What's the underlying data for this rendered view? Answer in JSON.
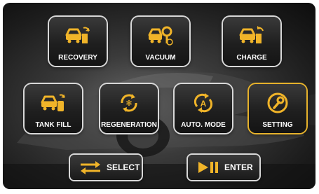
{
  "colors": {
    "accent": "#e6b22c",
    "icon": "#f0b429",
    "text": "#ffffff"
  },
  "tiles": [
    {
      "label": "RECOVERY",
      "icon": "car-recovery-icon",
      "active": false
    },
    {
      "label": "VACUUM",
      "icon": "car-vacuum-icon",
      "active": false
    },
    {
      "label": "CHARGE",
      "icon": "car-charge-icon",
      "active": false
    },
    {
      "label": "TANK FILL",
      "icon": "car-tank-fill-icon",
      "active": false
    },
    {
      "label": "REGENERATION",
      "icon": "regeneration-icon",
      "active": false
    },
    {
      "label": "AUTO. MODE",
      "icon": "auto-mode-icon",
      "active": false
    },
    {
      "label": "SETTING",
      "icon": "wrench-icon",
      "active": true
    }
  ],
  "buttons": {
    "select": {
      "label": "SELECT",
      "icon": "swap-arrows-icon"
    },
    "enter": {
      "label": "ENTER",
      "icon": "play-pause-icon"
    }
  }
}
